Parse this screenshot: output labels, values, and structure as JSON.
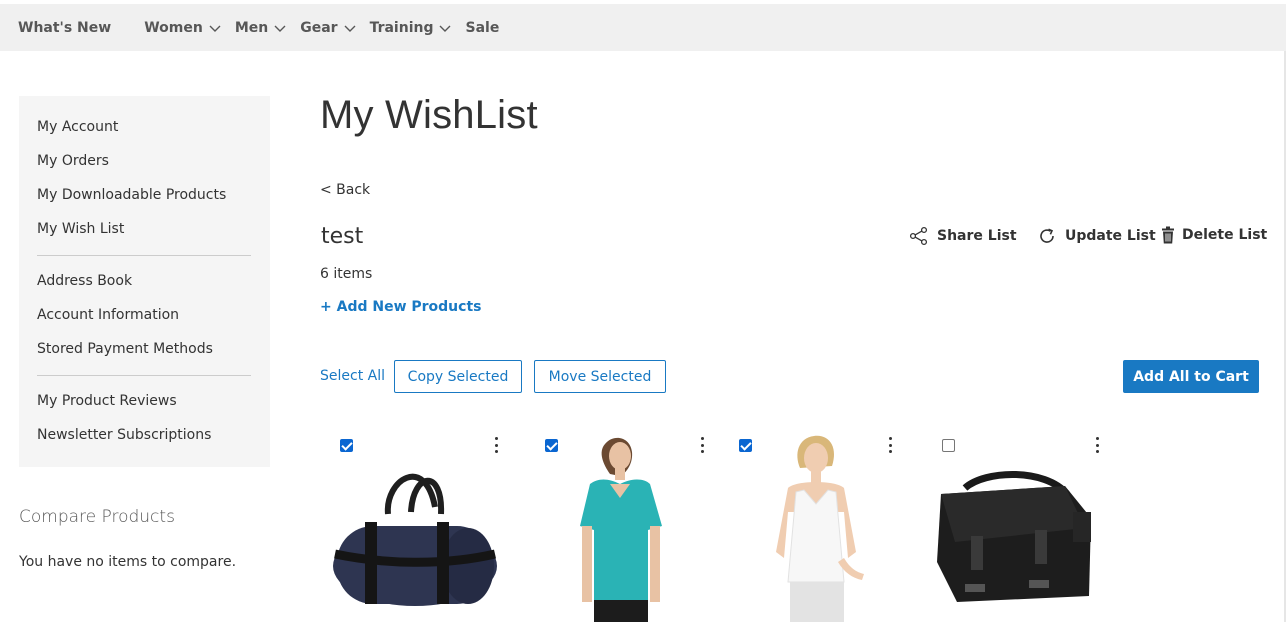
{
  "nav": {
    "items": [
      {
        "label": "What's New",
        "dropdown": false
      },
      {
        "label": "Women",
        "dropdown": true
      },
      {
        "label": "Men",
        "dropdown": true
      },
      {
        "label": "Gear",
        "dropdown": true
      },
      {
        "label": "Training",
        "dropdown": true
      },
      {
        "label": "Sale",
        "dropdown": false
      }
    ]
  },
  "sidebar": {
    "group1": [
      "My Account",
      "My Orders",
      "My Downloadable Products",
      "My Wish List"
    ],
    "group2": [
      "Address Book",
      "Account Information",
      "Stored Payment Methods"
    ],
    "group3": [
      "My Product Reviews",
      "Newsletter Subscriptions"
    ]
  },
  "compare": {
    "title": "Compare Products",
    "empty": "You have no items to compare."
  },
  "main": {
    "title": "My WishList",
    "back": "< Back",
    "list_name": "test",
    "item_count": "6 items",
    "add_products": "+ Add New Products",
    "share": "Share List",
    "update": "Update List",
    "delete": "Delete List",
    "select_all": "Select All",
    "copy_selected": "Copy Selected",
    "move_selected": "Move Selected",
    "add_all": "Add All to Cart"
  },
  "products": [
    {
      "name": "duffle-bag",
      "checked": true
    },
    {
      "name": "teal-tee",
      "checked": true
    },
    {
      "name": "white-tank",
      "checked": true
    },
    {
      "name": "messenger-bag",
      "checked": false
    }
  ],
  "colors": {
    "accent": "#1979c3",
    "nav_bg": "#f0f0f0",
    "sidebar_bg": "#f5f5f5"
  }
}
